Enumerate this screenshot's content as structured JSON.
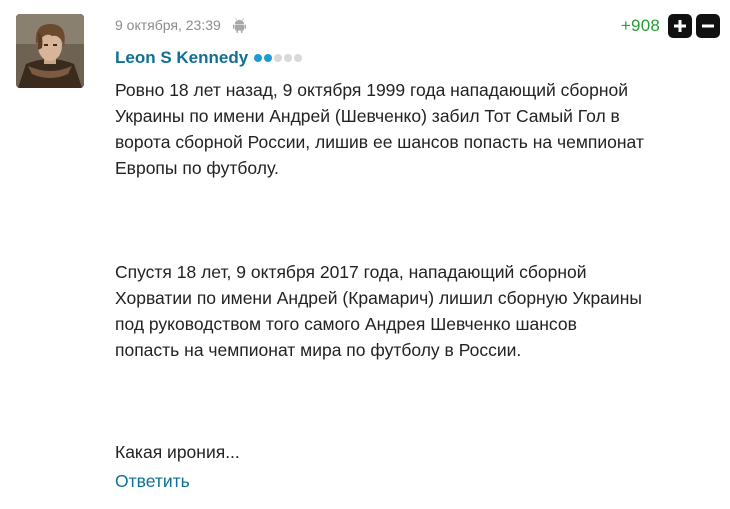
{
  "comment": {
    "timestamp": "9 октября, 23:39",
    "device_icon": "android-icon",
    "author": {
      "name": "Leon S Kennedy",
      "level_dots": {
        "filled": 2,
        "total": 5,
        "filled_color": "#1e9bd6",
        "empty_color": "#d9d9d9"
      }
    },
    "rating": {
      "value": "+908",
      "color": "#2a9c3a",
      "upvote_icon": "plus-icon",
      "downvote_icon": "minus-icon"
    },
    "paragraphs": [
      "Ровно 18 лет назад, 9 октября 1999 года нападающий сборной\nУкраины по имени Андрей (Шевченко) забил Тот Самый Гол в\nворота сборной России, лишив ее шансов попасть на чемпионат\nЕвропы по футболу.",
      "Спустя 18 лет, 9 октября 2017 года, нападающий сборной\nХорватии по имени Андрей (Крамарич) лишил сборную Украины\nпод руководством того самого Андрея Шевченко шансов\nпопасть на чемпионат мира по футболу в России.",
      "Какая ирония..."
    ],
    "reply_label": "Ответить",
    "link_color": "#0f6f94"
  }
}
